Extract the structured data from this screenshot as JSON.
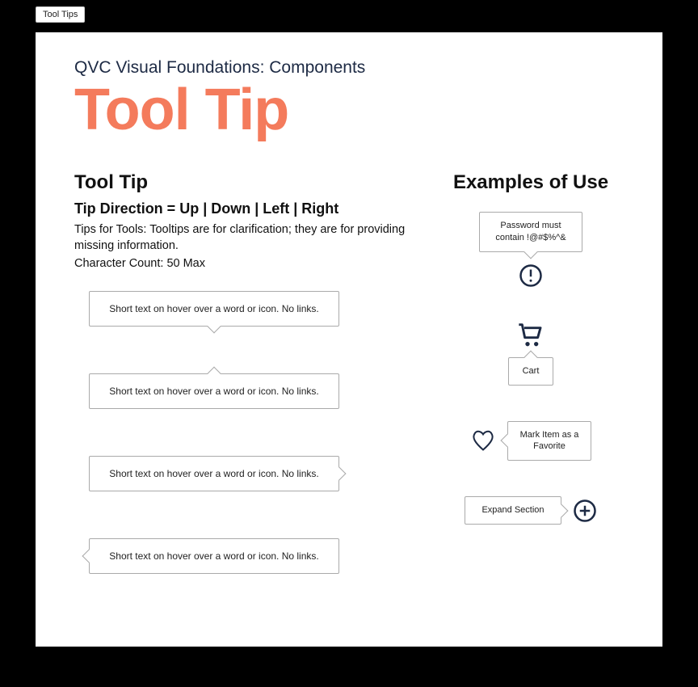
{
  "tab": "Tool Tips",
  "breadcrumb": "QVC Visual Foundations: Components",
  "title": "Tool Tip",
  "section_heading": "Tool Tip",
  "direction_label": "Tip Direction = Up | Down | Left | Right",
  "description": "Tips for Tools: Tooltips are for clarification; they are for providing missing information.",
  "char_count": "Character Count: 50 Max",
  "sample_text": "Short text on hover over a word or icon. No links.",
  "examples_heading": "Examples of Use",
  "ex1_text": "Password must contain !@#$%^&",
  "ex2_text": "Cart",
  "ex3_text": "Mark Item as a Favorite",
  "ex4_text": "Expand Section"
}
